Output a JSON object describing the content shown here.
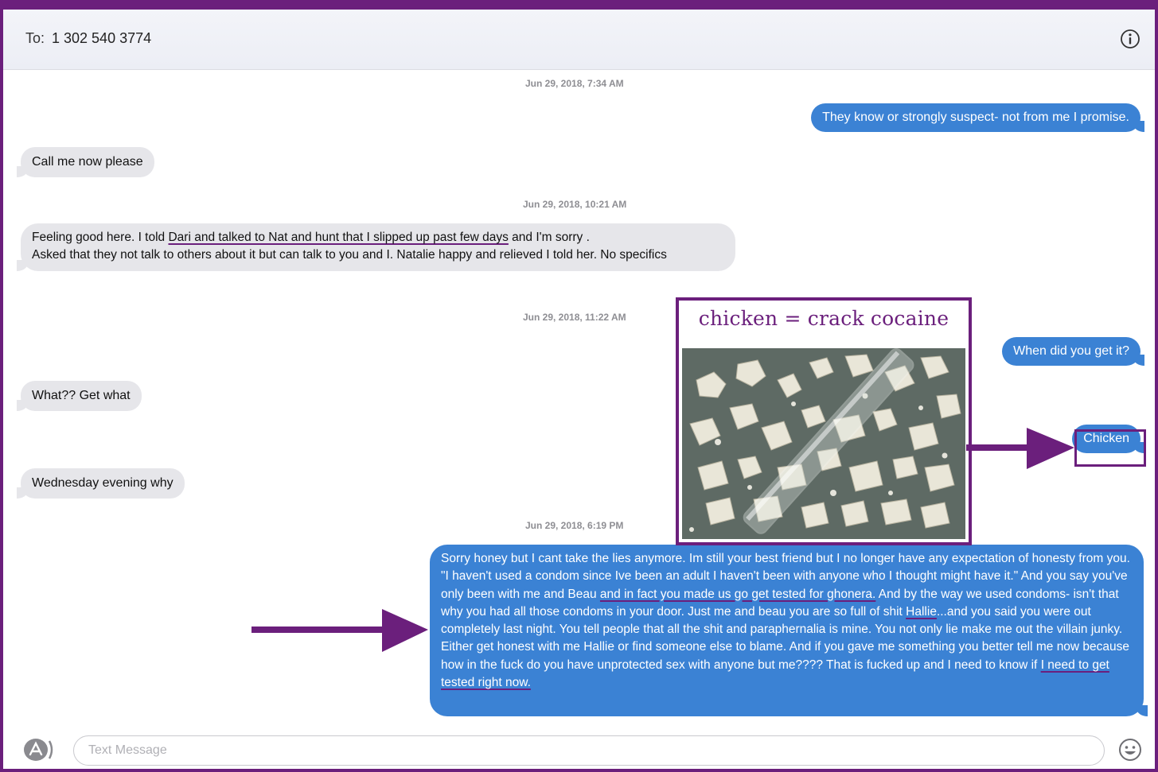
{
  "header": {
    "to_label": "To:",
    "recipient": "1 302 540 3774"
  },
  "timestamps": [
    "Jun 29, 2018, 7:34 AM",
    "Jun 29, 2018, 10:21 AM",
    "Jun 29, 2018, 11:22 AM",
    "Jun 29, 2018, 6:19 PM"
  ],
  "messages": {
    "m1": "They know or strongly suspect- not from me I promise.",
    "m2": "Call me now please",
    "m3": {
      "a": "Feeling good here. I told ",
      "b": "Dari and talked to Nat and hunt that I slipped up past few days",
      "c": " and I'm sorry .",
      "d": "Asked that they not talk to others about it but can talk to you and I. Natalie happy and relieved I told her. No specifics"
    },
    "m4": "When did you get it?",
    "m5": "What?? Get what",
    "m6": "Chicken",
    "m7": "Wednesday evening why",
    "m8": {
      "a": "Sorry honey but I cant take the lies anymore. Im still your best friend but I no longer have any expectation of honesty from you.  \"I haven't used a condom since Ive been an adult I haven't been with anyone who I thought might have it.\" And you say you've only been with me and Beau ",
      "b": "and in fact you made us go get tested for ghonera.",
      "c": "  And by the way we used condoms- isn't that why you had all those condoms in your door.  Just me and beau you are so full of shit ",
      "d": "Hallie",
      "e": "...and you said you were out completely last night. You tell people that all the shit and paraphernalia is mine. You not only lie make me out the villain junky.  Either get honest with me Hallie or find someone else to blame.  And if you gave me something you better tell me now because how in the fuck do you have unprotected sex with anyone but me???? That is fucked up and I need to know if ",
      "f": "I need to get tested right now."
    }
  },
  "annotation": {
    "title": "chicken = crack cocaine"
  },
  "composer": {
    "placeholder": "Text Message"
  },
  "icons": [
    "info-icon",
    "app-store-icon",
    "emoji-icon",
    "arrow-icon"
  ],
  "colors": {
    "annotation": "#6b1f7c",
    "outgoing_bubble": "#3b82d4",
    "incoming_bubble": "#e6e6ea",
    "timestamp": "#8e8e93"
  }
}
